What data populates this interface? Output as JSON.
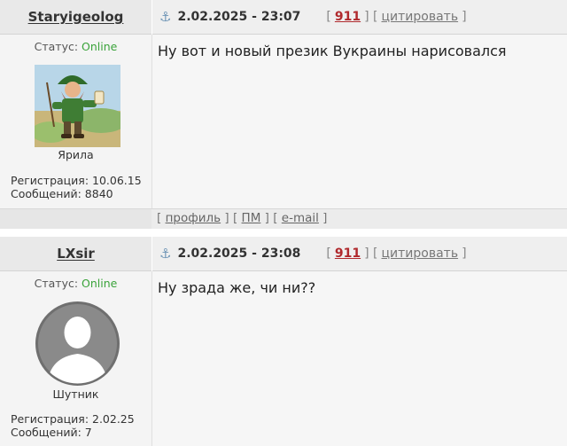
{
  "posts": [
    {
      "username": "Staryigeolog",
      "date": "2.02.2025 - 23:07",
      "post_number": "911",
      "quote_label": "цитировать",
      "status_label": "Статус:",
      "status_value": "Online",
      "rank": "Ярила",
      "registration": "Регистрация: 10.06.15",
      "messages": "Сообщений: 8840",
      "text": "Ну вот и новый презик Вукраины нарисовался",
      "footer_links": [
        "профиль",
        "ПМ",
        "e-mail"
      ]
    },
    {
      "username": "LXsir",
      "date": "2.02.2025 - 23:08",
      "post_number": "911",
      "quote_label": "цитировать",
      "status_label": "Статус:",
      "status_value": "Online",
      "rank": "Шутник",
      "registration": "Регистрация: 2.02.25",
      "messages": "Сообщений: 7",
      "text": "Ну зрада же, чи ни??"
    }
  ],
  "colors": {
    "online": "#3aa33a",
    "post_number": "#b0292d",
    "anchor_icon": "#6f95b6"
  },
  "icons": {
    "post_anchor": "anchor-icon"
  }
}
